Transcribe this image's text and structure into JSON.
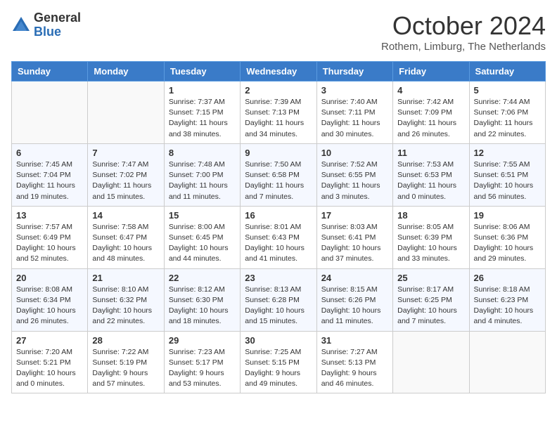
{
  "header": {
    "logo_general": "General",
    "logo_blue": "Blue",
    "month_title": "October 2024",
    "subtitle": "Rothem, Limburg, The Netherlands"
  },
  "days_of_week": [
    "Sunday",
    "Monday",
    "Tuesday",
    "Wednesday",
    "Thursday",
    "Friday",
    "Saturday"
  ],
  "weeks": [
    [
      {
        "day": "",
        "info": ""
      },
      {
        "day": "",
        "info": ""
      },
      {
        "day": "1",
        "info": "Sunrise: 7:37 AM\nSunset: 7:15 PM\nDaylight: 11 hours and 38 minutes."
      },
      {
        "day": "2",
        "info": "Sunrise: 7:39 AM\nSunset: 7:13 PM\nDaylight: 11 hours and 34 minutes."
      },
      {
        "day": "3",
        "info": "Sunrise: 7:40 AM\nSunset: 7:11 PM\nDaylight: 11 hours and 30 minutes."
      },
      {
        "day": "4",
        "info": "Sunrise: 7:42 AM\nSunset: 7:09 PM\nDaylight: 11 hours and 26 minutes."
      },
      {
        "day": "5",
        "info": "Sunrise: 7:44 AM\nSunset: 7:06 PM\nDaylight: 11 hours and 22 minutes."
      }
    ],
    [
      {
        "day": "6",
        "info": "Sunrise: 7:45 AM\nSunset: 7:04 PM\nDaylight: 11 hours and 19 minutes."
      },
      {
        "day": "7",
        "info": "Sunrise: 7:47 AM\nSunset: 7:02 PM\nDaylight: 11 hours and 15 minutes."
      },
      {
        "day": "8",
        "info": "Sunrise: 7:48 AM\nSunset: 7:00 PM\nDaylight: 11 hours and 11 minutes."
      },
      {
        "day": "9",
        "info": "Sunrise: 7:50 AM\nSunset: 6:58 PM\nDaylight: 11 hours and 7 minutes."
      },
      {
        "day": "10",
        "info": "Sunrise: 7:52 AM\nSunset: 6:55 PM\nDaylight: 11 hours and 3 minutes."
      },
      {
        "day": "11",
        "info": "Sunrise: 7:53 AM\nSunset: 6:53 PM\nDaylight: 11 hours and 0 minutes."
      },
      {
        "day": "12",
        "info": "Sunrise: 7:55 AM\nSunset: 6:51 PM\nDaylight: 10 hours and 56 minutes."
      }
    ],
    [
      {
        "day": "13",
        "info": "Sunrise: 7:57 AM\nSunset: 6:49 PM\nDaylight: 10 hours and 52 minutes."
      },
      {
        "day": "14",
        "info": "Sunrise: 7:58 AM\nSunset: 6:47 PM\nDaylight: 10 hours and 48 minutes."
      },
      {
        "day": "15",
        "info": "Sunrise: 8:00 AM\nSunset: 6:45 PM\nDaylight: 10 hours and 44 minutes."
      },
      {
        "day": "16",
        "info": "Sunrise: 8:01 AM\nSunset: 6:43 PM\nDaylight: 10 hours and 41 minutes."
      },
      {
        "day": "17",
        "info": "Sunrise: 8:03 AM\nSunset: 6:41 PM\nDaylight: 10 hours and 37 minutes."
      },
      {
        "day": "18",
        "info": "Sunrise: 8:05 AM\nSunset: 6:39 PM\nDaylight: 10 hours and 33 minutes."
      },
      {
        "day": "19",
        "info": "Sunrise: 8:06 AM\nSunset: 6:36 PM\nDaylight: 10 hours and 29 minutes."
      }
    ],
    [
      {
        "day": "20",
        "info": "Sunrise: 8:08 AM\nSunset: 6:34 PM\nDaylight: 10 hours and 26 minutes."
      },
      {
        "day": "21",
        "info": "Sunrise: 8:10 AM\nSunset: 6:32 PM\nDaylight: 10 hours and 22 minutes."
      },
      {
        "day": "22",
        "info": "Sunrise: 8:12 AM\nSunset: 6:30 PM\nDaylight: 10 hours and 18 minutes."
      },
      {
        "day": "23",
        "info": "Sunrise: 8:13 AM\nSunset: 6:28 PM\nDaylight: 10 hours and 15 minutes."
      },
      {
        "day": "24",
        "info": "Sunrise: 8:15 AM\nSunset: 6:26 PM\nDaylight: 10 hours and 11 minutes."
      },
      {
        "day": "25",
        "info": "Sunrise: 8:17 AM\nSunset: 6:25 PM\nDaylight: 10 hours and 7 minutes."
      },
      {
        "day": "26",
        "info": "Sunrise: 8:18 AM\nSunset: 6:23 PM\nDaylight: 10 hours and 4 minutes."
      }
    ],
    [
      {
        "day": "27",
        "info": "Sunrise: 7:20 AM\nSunset: 5:21 PM\nDaylight: 10 hours and 0 minutes."
      },
      {
        "day": "28",
        "info": "Sunrise: 7:22 AM\nSunset: 5:19 PM\nDaylight: 9 hours and 57 minutes."
      },
      {
        "day": "29",
        "info": "Sunrise: 7:23 AM\nSunset: 5:17 PM\nDaylight: 9 hours and 53 minutes."
      },
      {
        "day": "30",
        "info": "Sunrise: 7:25 AM\nSunset: 5:15 PM\nDaylight: 9 hours and 49 minutes."
      },
      {
        "day": "31",
        "info": "Sunrise: 7:27 AM\nSunset: 5:13 PM\nDaylight: 9 hours and 46 minutes."
      },
      {
        "day": "",
        "info": ""
      },
      {
        "day": "",
        "info": ""
      }
    ]
  ]
}
